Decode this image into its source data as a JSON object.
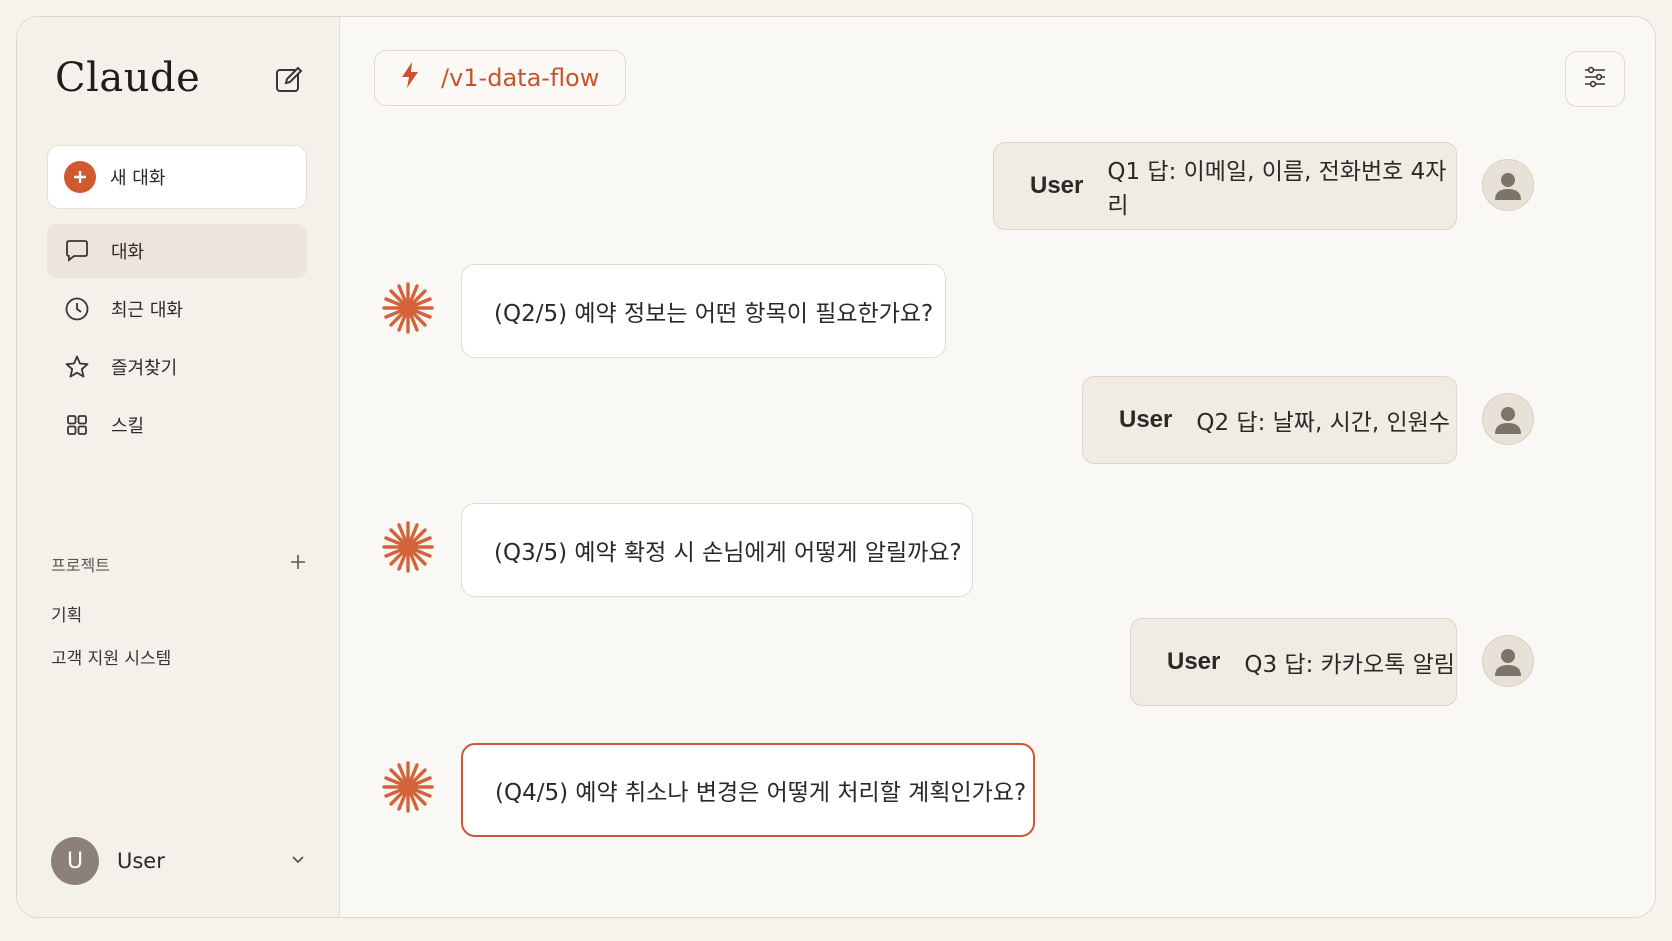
{
  "sidebar": {
    "brand": "Claude",
    "new_chat_label": "새 대화",
    "nav": [
      {
        "label": "대화",
        "icon": "chat-bubble-icon",
        "active": true
      },
      {
        "label": "최근 대화",
        "icon": "clock-icon"
      },
      {
        "label": "즐겨찾기",
        "icon": "star-icon"
      },
      {
        "label": "스킬",
        "icon": "grid-icon"
      }
    ],
    "projects_header": "프로젝트",
    "projects": [
      "기획",
      "고객 지원 시스템"
    ],
    "user": {
      "initial": "U",
      "name": "User"
    }
  },
  "header": {
    "route": "/v1-data-flow"
  },
  "conversation": [
    {
      "role": "user",
      "label": "User",
      "text": "Q1 답: 이메일, 이름, 전화번호 4자리"
    },
    {
      "role": "assistant",
      "text": "(Q2/5) 예약 정보는 어떤 항목이 필요한가요?"
    },
    {
      "role": "user",
      "label": "User",
      "text": "Q2 답: 날짜, 시간, 인원수"
    },
    {
      "role": "assistant",
      "text": "(Q3/5) 예약 확정 시 손님에게 어떻게 알릴까요?"
    },
    {
      "role": "user",
      "label": "User",
      "text": "Q3 답: 카카오톡 알림"
    },
    {
      "role": "assistant",
      "text": "(Q4/5) 예약 취소나 변경은 어떻게 처리할 계획인가요?",
      "highlighted": true
    }
  ],
  "colors": {
    "accent": "#c5552d",
    "background": "#f7f3ec",
    "user_bubble": "#f0ebe3"
  }
}
